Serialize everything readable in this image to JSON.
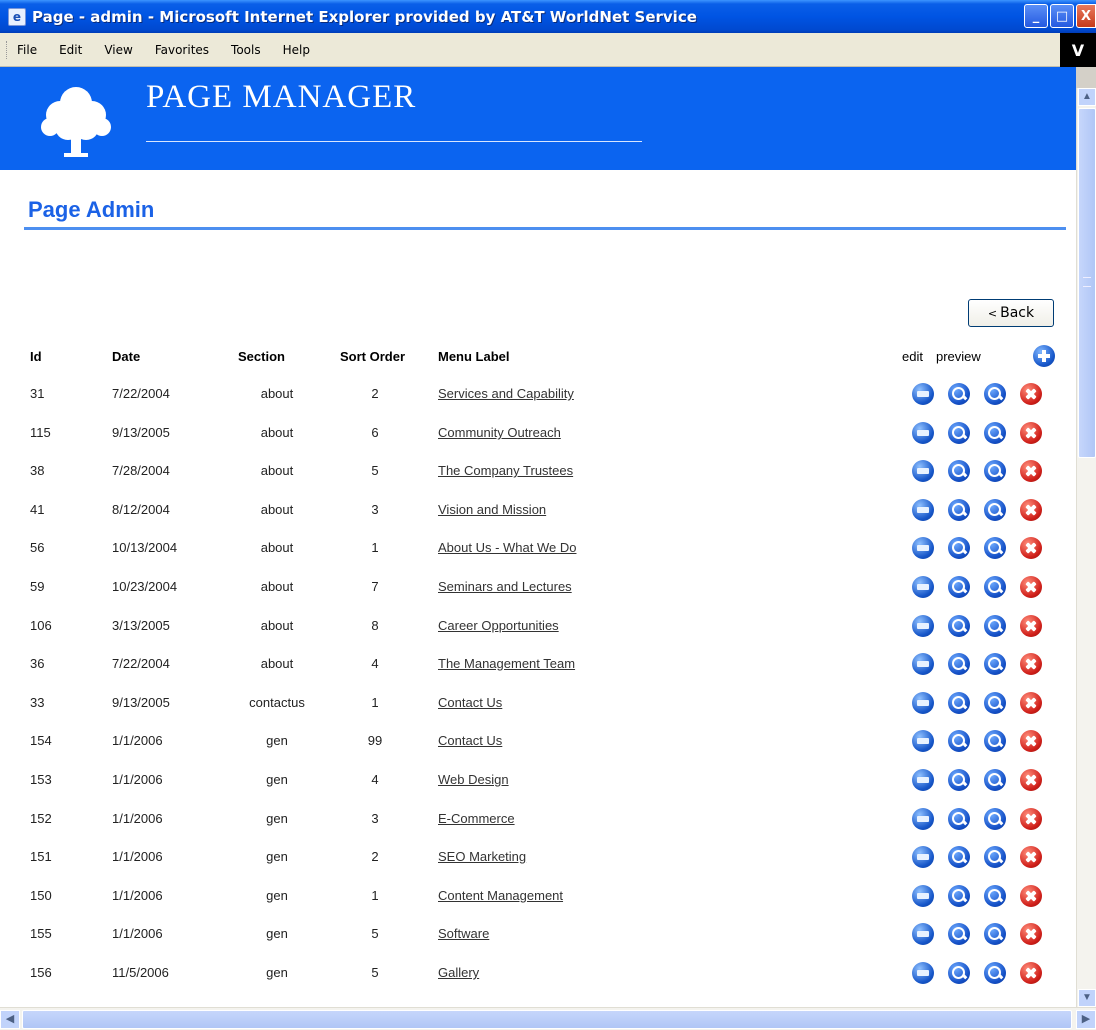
{
  "window": {
    "title": "Page - admin - Microsoft Internet Explorer provided by AT&T WorldNet Service",
    "icon_glyph": "e",
    "minimize_glyph": "_",
    "maximize_glyph": "□",
    "close_glyph": "X"
  },
  "menu": {
    "items": [
      "File",
      "Edit",
      "View",
      "Favorites",
      "Tools",
      "Help"
    ],
    "logo_text": "V"
  },
  "banner": {
    "title": "PAGE MANAGER"
  },
  "page": {
    "heading": "Page Admin",
    "back_label": "Back",
    "back_chevron": "<"
  },
  "table": {
    "headers": {
      "id": "Id",
      "date": "Date",
      "section": "Section",
      "sort_order": "Sort Order",
      "menu_label": "Menu Label",
      "edit": "edit",
      "preview": "preview"
    },
    "rows": [
      {
        "id": "31",
        "date": "7/22/2004",
        "section": "about",
        "sort": "2",
        "label": "Services and Capability"
      },
      {
        "id": "115",
        "date": "9/13/2005",
        "section": "about",
        "sort": "6",
        "label": "Community Outreach"
      },
      {
        "id": "38",
        "date": "7/28/2004",
        "section": "about",
        "sort": "5",
        "label": "The Company Trustees"
      },
      {
        "id": "41",
        "date": "8/12/2004",
        "section": "about",
        "sort": "3",
        "label": "Vision and Mission"
      },
      {
        "id": "56",
        "date": "10/13/2004",
        "section": "about",
        "sort": "1",
        "label": "About Us - What We Do"
      },
      {
        "id": "59",
        "date": "10/23/2004",
        "section": "about",
        "sort": "7",
        "label": "Seminars and Lectures"
      },
      {
        "id": "106",
        "date": "3/13/2005",
        "section": "about",
        "sort": "8",
        "label": "Career Opportunities"
      },
      {
        "id": "36",
        "date": "7/22/2004",
        "section": "about",
        "sort": "4",
        "label": "The Management Team"
      },
      {
        "id": "33",
        "date": "9/13/2005",
        "section": "contactus",
        "sort": "1",
        "label": "Contact Us"
      },
      {
        "id": "154",
        "date": "1/1/2006",
        "section": "gen",
        "sort": "99",
        "label": "Contact Us"
      },
      {
        "id": "153",
        "date": "1/1/2006",
        "section": "gen",
        "sort": "4",
        "label": "Web Design"
      },
      {
        "id": "152",
        "date": "1/1/2006",
        "section": "gen",
        "sort": "3",
        "label": "E-Commerce"
      },
      {
        "id": "151",
        "date": "1/1/2006",
        "section": "gen",
        "sort": "2",
        "label": "SEO Marketing"
      },
      {
        "id": "150",
        "date": "1/1/2006",
        "section": "gen",
        "sort": "1",
        "label": "Content Management"
      },
      {
        "id": "155",
        "date": "1/1/2006",
        "section": "gen",
        "sort": "5",
        "label": "Software"
      },
      {
        "id": "156",
        "date": "11/5/2006",
        "section": "gen",
        "sort": "5",
        "label": "Gallery"
      }
    ]
  },
  "scroll": {
    "up": "▲",
    "down": "▼",
    "left": "◀",
    "right": "▶"
  },
  "colors": {
    "banner": "#0b64f0",
    "heading": "#1b62e6"
  }
}
